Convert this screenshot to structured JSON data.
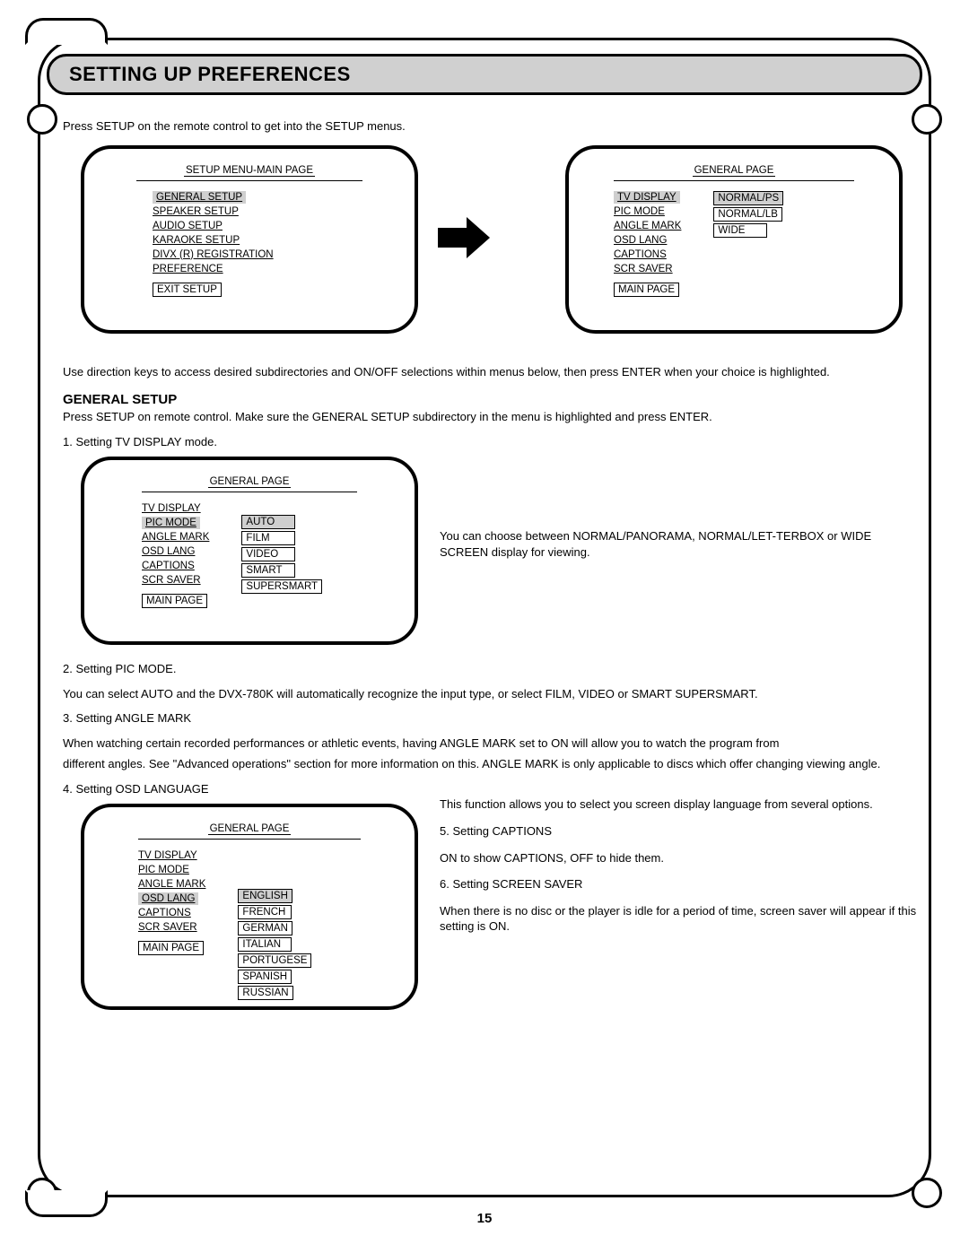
{
  "header": {
    "title": "SETTING UP PREFERENCES"
  },
  "intro": "Press SETUP on the remote control to get into the SETUP menus.",
  "panel1": {
    "title": "SETUP MENU-MAIN PAGE",
    "items": [
      "GENERAL SETUP",
      "SPEAKER SETUP",
      "AUDIO SETUP",
      "KARAOKE SETUP",
      "DIVX (R) REGISTRATION",
      "PREFERENCE"
    ],
    "exit": "EXIT SETUP"
  },
  "panel2": {
    "title": "GENERAL PAGE",
    "left": [
      "TV DISPLAY",
      "PIC MODE",
      "ANGLE MARK",
      "OSD LANG",
      "CAPTIONS",
      "SCR SAVER"
    ],
    "right": [
      "NORMAL/PS",
      "NORMAL/LB",
      "WIDE"
    ],
    "main": "MAIN PAGE"
  },
  "after_panels": "Use direction keys to access desired subdirectories and ON/OFF selections within menus below, then press ENTER when your choice is highlighted.",
  "general": {
    "heading": "GENERAL SETUP",
    "intro": "Press SETUP on remote control.  Make sure the GENERAL SETUP subdirectory in the menu is highlighted and press ENTER.",
    "step1": "1. Setting TV DISPLAY mode.",
    "step1_right": "You can choose between NORMAL/PANORAMA, NORMAL/LET-TERBOX or WIDE SCREEN display for viewing.",
    "panel3": {
      "title": "GENERAL PAGE",
      "left": [
        "TV DISPLAY",
        "PIC MODE",
        "ANGLE MARK",
        "OSD LANG",
        "CAPTIONS",
        "SCR SAVER"
      ],
      "right": [
        "AUTO",
        "FILM",
        "VIDEO",
        "SMART",
        "SUPERSMART"
      ],
      "main": "MAIN PAGE"
    },
    "step2": "2. Setting PIC MODE.",
    "step2_body": "You can select AUTO and the DVX-780K will automatically recognize the input type, or select FILM, VIDEO or SMART SUPERSMART.",
    "step3": "3. Setting ANGLE MARK",
    "step3_body1": "When watching certain recorded performances or athletic events, having ANGLE MARK set to ON will allow you to watch the program from",
    "step3_body2": "different angles.  See \"Advanced operations\" section for more information on this.  ANGLE MARK is only applicable to discs which offer changing viewing angle.",
    "step4": "4. Setting OSD LANGUAGE",
    "panel4": {
      "title": "GENERAL PAGE",
      "left": [
        "TV DISPLAY",
        "PIC MODE",
        "ANGLE MARK",
        "OSD LANG",
        "CAPTIONS",
        "SCR SAVER"
      ],
      "right": [
        "ENGLISH",
        "FRENCH",
        "GERMAN",
        "ITALIAN",
        "PORTUGESE",
        "SPANISH",
        "RUSSIAN"
      ],
      "main": "MAIN PAGE"
    },
    "right_col": {
      "p1": "This function allows you to select you screen display language from several options.",
      "p2": "5. Setting CAPTIONS",
      "p3": "ON to show CAPTIONS, OFF to hide them.",
      "p4": "6. Setting SCREEN SAVER",
      "p5": "When there is no disc or the player is idle for a period of time, screen saver will appear if this setting is ON."
    }
  },
  "page_number": "15"
}
